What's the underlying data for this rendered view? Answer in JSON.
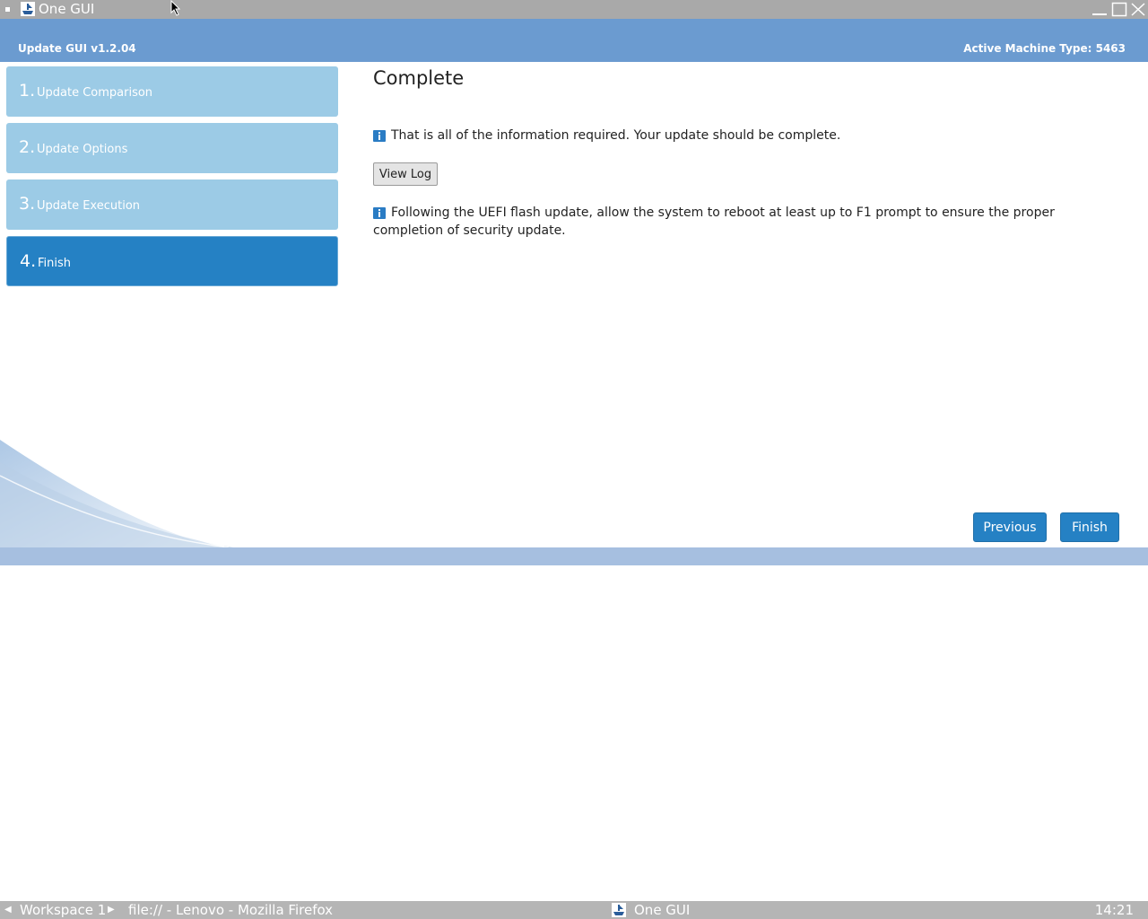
{
  "window": {
    "title": "One GUI",
    "icons": {
      "app": "lenovo-ship-icon",
      "min": "minimize-icon",
      "max": "maximize-icon",
      "close": "close-icon"
    }
  },
  "header": {
    "version": "Update GUI v1.2.04",
    "machine_type": "Active Machine Type: 5463"
  },
  "steps": [
    {
      "num": "1.",
      "label": "Update Comparison",
      "active": false
    },
    {
      "num": "2.",
      "label": "Update Options",
      "active": false
    },
    {
      "num": "3.",
      "label": "Update Execution",
      "active": false
    },
    {
      "num": "4.",
      "label": "Finish",
      "active": true
    }
  ],
  "main": {
    "title": "Complete",
    "info1": "That is all of the information required. Your update should be complete.",
    "view_log_label": "View Log",
    "info2": "Following the UEFI flash update, allow the system to reboot at least up to F1 prompt to ensure the proper completion of security update.",
    "info_icon": "info-icon"
  },
  "nav": {
    "previous": "Previous",
    "finish": "Finish"
  },
  "colors": {
    "header": "#6b9bd0",
    "step_inactive": "#9ccbe6",
    "step_active": "#2581c4",
    "button": "#2581c4",
    "footer_band": "#a6bfe0"
  },
  "taskbar": {
    "workspace": "Workspace 1",
    "browser_task": "file:// - Lenovo - Mozilla Firefox",
    "active_task": "One GUI",
    "clock": "14:21",
    "left_arrow": "◀",
    "right_arrow": "▶"
  }
}
